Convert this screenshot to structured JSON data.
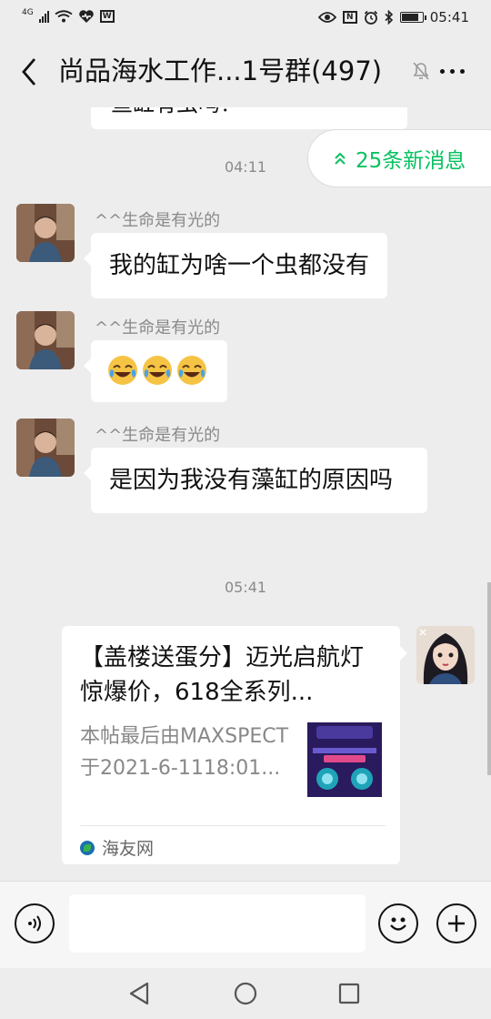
{
  "status_bar": {
    "network": "4G",
    "time": "05:41",
    "wps_label": "W",
    "nfc_label": "N"
  },
  "header": {
    "title": "尚品海水工作...1号群(497)"
  },
  "chat": {
    "partial_message": "鱼缸有虫吗？",
    "new_messages_label": "25条新消息",
    "timestamps": [
      "04:11",
      "05:41"
    ],
    "messages": [
      {
        "sender": "^^生命是有光的",
        "text": "我的缸为啥一个虫都没有"
      },
      {
        "sender": "^^生命是有光的",
        "emoji_count": 3,
        "emoji": "face-with-tears-of-joy"
      },
      {
        "sender": "^^生命是有光的",
        "text": "是因为我没有藻缸的原因吗"
      }
    ],
    "link_card": {
      "title": "【盖楼送蛋分】迈光启航灯惊爆价，618全系列...",
      "description": "本帖最后由MAXSPECT于2021-6-1118:01...",
      "source": "海友网"
    }
  },
  "input_bar": {
    "placeholder": ""
  },
  "colors": {
    "accent": "#07c160",
    "background": "#ededed",
    "bubble": "#ffffff"
  }
}
